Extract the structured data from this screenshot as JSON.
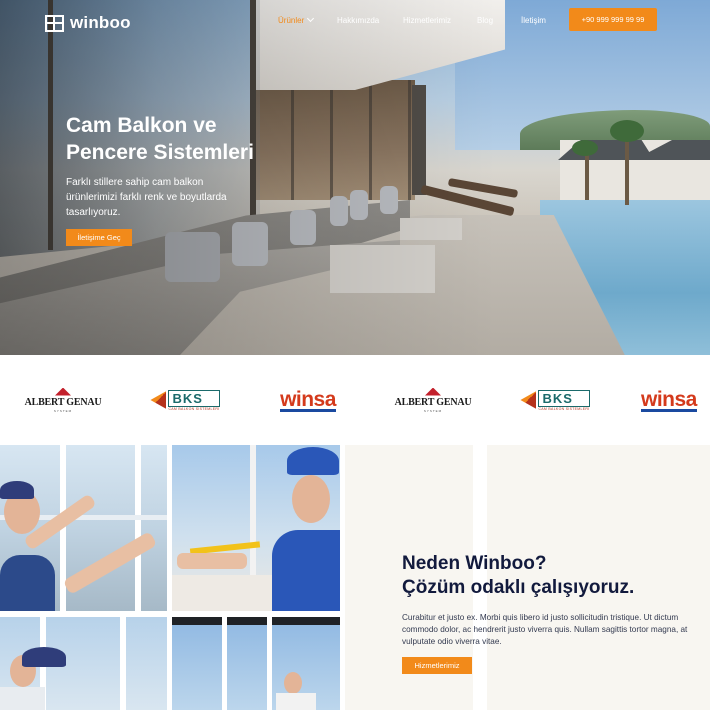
{
  "brand": {
    "logo_text": "winboo",
    "accent": "#f28a1a",
    "navy": "#121a3d"
  },
  "nav": {
    "items": [
      {
        "label": "Ürünler",
        "active": true,
        "has_dropdown": true
      },
      {
        "label": "Hakkımızda",
        "active": false
      },
      {
        "label": "Hizmetlerimiz",
        "active": false
      },
      {
        "label": "Blog",
        "active": false
      },
      {
        "label": "İletişim",
        "active": false
      }
    ],
    "phone": "+90 999 999 99 99"
  },
  "hero": {
    "title_line1": "Cam Balkon ve",
    "title_line2": "Pencere Sistemleri",
    "subtitle": "Farklı stillere sahip cam balkon ürünlerimizi farklı renk ve boyutlarda tasarlıyoruz.",
    "cta": "İletişime Geç"
  },
  "brands": [
    {
      "name": "ALBERT GENAU",
      "tagline": "SYSTEM"
    },
    {
      "name": "BKS",
      "tagline": "CAM BALKON SİSTEMLERİ"
    },
    {
      "name": "winsa"
    },
    {
      "name": "ALBERT GENAU",
      "tagline": "SYSTEM"
    },
    {
      "name": "BKS",
      "tagline": "CAM BALKON SİSTEMLERİ"
    },
    {
      "name": "winsa"
    }
  ],
  "why": {
    "title_line1": "Neden Winboo?",
    "title_line2": "Çözüm odaklı çalışıyoruz.",
    "text": "Curabitur et justo ex. Morbi quis libero id justo sollicitudin tristique. Ut dictum commodo dolor, ac hendrerit justo viverra quis. Nullam sagittis tortor magna, at vulputate odio viverra vitae.",
    "cta": "Hizmetlerimiz"
  }
}
